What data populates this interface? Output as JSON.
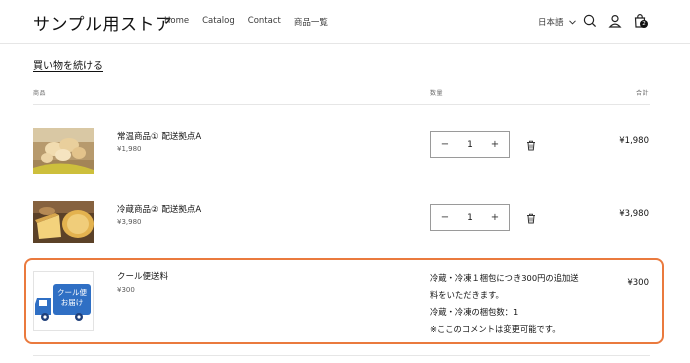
{
  "store": {
    "name": "サンプル用ストア"
  },
  "nav": [
    {
      "label": "Home"
    },
    {
      "label": "Catalog"
    },
    {
      "label": "Contact"
    },
    {
      "label": "商品一覧"
    }
  ],
  "header": {
    "language": "日本語",
    "cart_count": "2"
  },
  "cart": {
    "continue_label": "買い物を続ける",
    "columns": {
      "product": "商品",
      "quantity": "数量",
      "total": "合計"
    },
    "items": [
      {
        "name": "常温商品① 配送拠点A",
        "price": "¥1,980",
        "quantity": "1",
        "total": "¥1,980",
        "image": "bread-photo"
      },
      {
        "name": "冷蔵商品② 配送拠点A",
        "price": "¥3,980",
        "quantity": "1",
        "total": "¥3,980",
        "image": "cheese-photo"
      }
    ],
    "shipping_fee": {
      "name": "クール便送料",
      "price": "¥300",
      "total": "¥300",
      "image_text": [
        "クール便",
        "お届け"
      ],
      "comment_lines": [
        "冷蔵・冷凍１梱包につき300円の追加送",
        "料をいただきます。",
        "冷蔵・冷凍の梱包数：1",
        "※ここのコメントは変更可能です。"
      ]
    }
  },
  "icons": {
    "decrease": "minus-icon",
    "increase": "plus-icon",
    "remove": "trash-icon"
  },
  "colors": {
    "highlight": "#ea7a3e",
    "truck": "#2f6fc4",
    "text": "#121212"
  }
}
